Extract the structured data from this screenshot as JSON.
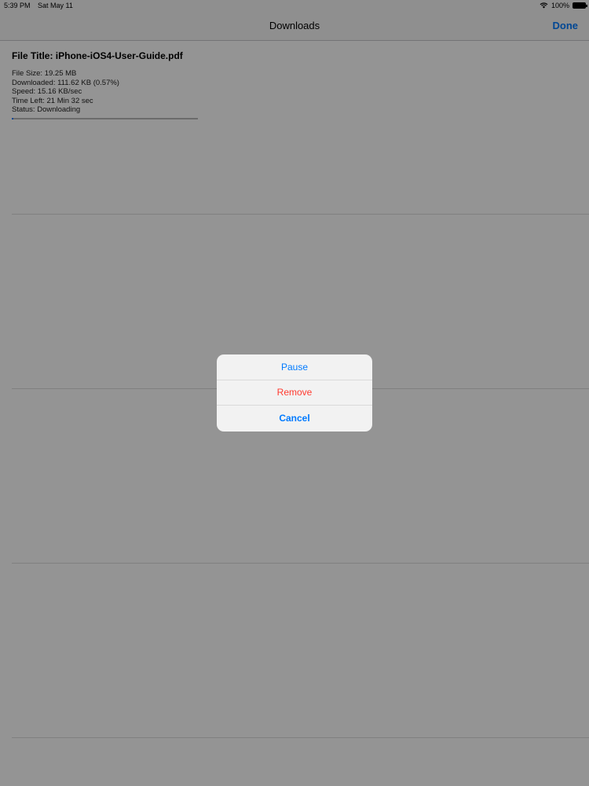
{
  "status_bar": {
    "time": "5:39 PM",
    "date": "Sat May 11",
    "battery": "100%"
  },
  "nav": {
    "title": "Downloads",
    "done_label": "Done"
  },
  "downloads": [
    {
      "title": "File Title: iPhone-iOS4-User-Guide.pdf",
      "file_size": "File Size: 19.25 MB",
      "downloaded": "Downloaded: 111.62 KB (0.57%)",
      "speed": "Speed: 15.16 KB/sec",
      "time_left": "Time Left: 21 Min 32 sec",
      "status": "Status: Downloading",
      "progress_percent": 0.57
    }
  ],
  "action_sheet": {
    "pause_label": "Pause",
    "remove_label": "Remove",
    "cancel_label": "Cancel"
  },
  "colors": {
    "accent": "#007aff",
    "destructive": "#ff3b30"
  }
}
